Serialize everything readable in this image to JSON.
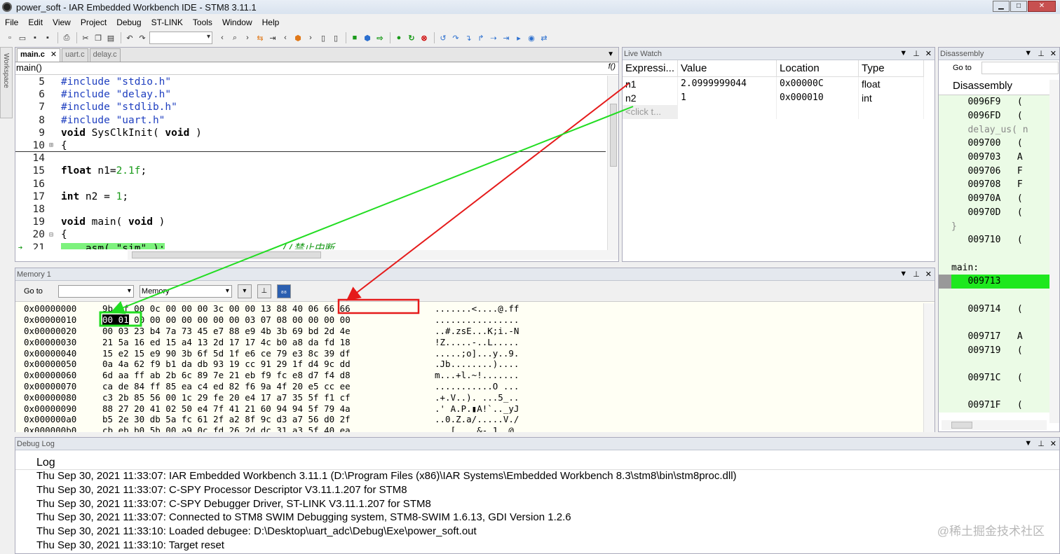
{
  "window": {
    "title": "power_soft - IAR Embedded Workbench IDE - STM8 3.11.1"
  },
  "menu": [
    "File",
    "Edit",
    "View",
    "Project",
    "Debug",
    "ST-LINK",
    "Tools",
    "Window",
    "Help"
  ],
  "workspace_strip_label": "Workspace",
  "editor": {
    "tabs": [
      {
        "label": "main.c",
        "active": true
      },
      {
        "label": "uart.c"
      },
      {
        "label": "delay.c"
      }
    ],
    "function_scope": "main()",
    "func_button": "f()",
    "lines": [
      {
        "n": "5",
        "code": "#include \"stdio.h\""
      },
      {
        "n": "6",
        "code": "#include \"delay.h\""
      },
      {
        "n": "7",
        "code": "#include \"stdlib.h\""
      },
      {
        "n": "8",
        "code": "#include \"uart.h\""
      },
      {
        "n": "9",
        "kw": "void",
        "code": " SysClkInit( ",
        "kw2": "void",
        "tail": " )"
      },
      {
        "n": "10",
        "code": "{",
        "fold": "⊞"
      },
      {
        "n": "14",
        "code": ""
      },
      {
        "n": "15",
        "kw": "float",
        "code": " n1=",
        "num": "2.1f",
        "tail": ";"
      },
      {
        "n": "16",
        "code": ""
      },
      {
        "n": "17",
        "kw": "int",
        "code": " n2 = ",
        "num": "1",
        "tail": ";"
      },
      {
        "n": "18",
        "code": ""
      },
      {
        "n": "19",
        "kw": "void",
        "code": " main( ",
        "kw2": "void",
        "tail": " )"
      },
      {
        "n": "20",
        "code": "{",
        "fold": "⊟"
      },
      {
        "n": "21",
        "code": "    asm( \"sim\" );",
        "comment": "//禁止中断",
        "current": true
      }
    ]
  },
  "live_watch": {
    "title": "Live Watch",
    "headers": [
      "Expressi...",
      "Value",
      "Location",
      "Type"
    ],
    "rows": [
      {
        "expr": "n1",
        "value": "2.0999999044",
        "location": "0x00000C",
        "type": "float"
      },
      {
        "expr": "n2",
        "value": "1",
        "location": "0x000010",
        "type": "int"
      }
    ],
    "placeholder": "<click t..."
  },
  "disassembly": {
    "title": "Disassembly",
    "goto_label": "Go to",
    "header": "Disassembly",
    "rows": [
      {
        "text": "   0096F9   (",
        "kind": "code"
      },
      {
        "text": "   0096FD   (",
        "kind": "code"
      },
      {
        "text": "   delay_us( n",
        "kind": "src"
      },
      {
        "text": "   009700   (",
        "kind": "code"
      },
      {
        "text": "   009703   A",
        "kind": "code"
      },
      {
        "text": "   009706   F",
        "kind": "code"
      },
      {
        "text": "   009708   F",
        "kind": "code"
      },
      {
        "text": "   00970A   (",
        "kind": "code"
      },
      {
        "text": "   00970D   (",
        "kind": "code"
      },
      {
        "text": "}",
        "kind": "src"
      },
      {
        "text": "   009710   (",
        "kind": "code"
      },
      {
        "text": "",
        "kind": "blank"
      },
      {
        "text": "main:",
        "kind": "label"
      },
      {
        "text": "   009713   ",
        "kind": "pc"
      },
      {
        "text": "",
        "kind": "blank"
      },
      {
        "text": "   009714   (",
        "kind": "code"
      },
      {
        "text": "",
        "kind": "blank"
      },
      {
        "text": "   009717   A",
        "kind": "code"
      },
      {
        "text": "   009719   (",
        "kind": "code"
      },
      {
        "text": "",
        "kind": "blank"
      },
      {
        "text": "   00971C   (",
        "kind": "code"
      },
      {
        "text": "",
        "kind": "blank"
      },
      {
        "text": "   00971F   (",
        "kind": "code"
      }
    ]
  },
  "memory": {
    "title": "Memory 1",
    "goto_label": "Go to",
    "zone": "Memory",
    "rows": [
      {
        "addr": "0x00000000",
        "bytes": "9b 1f 00 0c 00 00 00 3c 00 00 13 88 40 06 66 66",
        "ascii": ".......<....@.ff"
      },
      {
        "addr": "0x00000010",
        "bytes": "00 01 00 00 00 00 00 00 00 03 07 08 00 00 00 00",
        "ascii": "................"
      },
      {
        "addr": "0x00000020",
        "bytes": "00 03 23 b4 7a 73 45 e7 88 e9 4b 3b 69 bd 2d 4e",
        "ascii": "..#.zsE...K;i.-N"
      },
      {
        "addr": "0x00000030",
        "bytes": "21 5a 16 ed 15 a4 13 2d 17 17 4c b0 a8 da fd 18",
        "ascii": "!Z.....-..L....."
      },
      {
        "addr": "0x00000040",
        "bytes": "15 e2 15 e9 90 3b 6f 5d 1f e6 ce 79 e3 8c 39 df",
        "ascii": ".....;o]...y..9."
      },
      {
        "addr": "0x00000050",
        "bytes": "0a 4a 62 f9 b1 da db 93 19 cc 91 29 1f d4 9c dd",
        "ascii": ".Jb........)...."
      },
      {
        "addr": "0x00000060",
        "bytes": "6d aa ff ab 2b 6c 89 7e 21 eb f9 fc e8 d7 f4 d8",
        "ascii": "m...+l.~!......."
      },
      {
        "addr": "0x00000070",
        "bytes": "ca de 84 ff 85 ea c4 ed 82 f6 9a 4f 20 e5 cc ee",
        "ascii": "...........O ..."
      },
      {
        "addr": "0x00000080",
        "bytes": "c3 2b 85 56 00 1c 29 fe 20 e4 17 a7 35 5f f1 cf",
        "ascii": ".+.V..). ...5_.."
      },
      {
        "addr": "0x00000090",
        "bytes": "88 27 20 41 02 50 e4 7f 41 21 60 94 94 5f 79 4a",
        "ascii": ".' A.P.▮A!`.._yJ"
      },
      {
        "addr": "0x000000a0",
        "bytes": "b5 2e 30 db 5a fc 61 2f a2 8f 9c d3 a7 56 d0 2f",
        "ascii": "..0.Z.a/.....V./"
      },
      {
        "addr": "0x000000b0",
        "bytes": "cb eb b0 5b 00 a9 0c fd 26 2d dc 31 a3 5f 40 ea",
        "ascii": "...[....&-.1._@."
      }
    ]
  },
  "debug_log": {
    "title": "Debug Log",
    "header": "Log",
    "lines": [
      "Thu Sep 30, 2021 11:33:07: IAR Embedded Workbench 3.11.1 (D:\\Program Files (x86)\\IAR Systems\\Embedded Workbench 8.3\\stm8\\bin\\stm8proc.dll)",
      "Thu Sep 30, 2021 11:33:07: C-SPY Processor Descriptor V3.11.1.207 for STM8",
      "Thu Sep 30, 2021 11:33:07: C-SPY Debugger Driver, ST-LINK V3.11.1.207 for STM8",
      "Thu Sep 30, 2021 11:33:07: Connected to STM8 SWIM Debugging system, STM8-SWIM 1.6.13, GDI Version 1.2.6",
      "Thu Sep 30, 2021 11:33:10: Loaded debugee: D:\\Desktop\\uart_adc\\Debug\\Exe\\power_soft.out",
      "Thu Sep 30, 2021 11:33:10: Target reset"
    ]
  },
  "watermark": "@稀土掘金技术社区",
  "annotation_colors": {
    "red": "#e51b1b",
    "green": "#22dd22"
  }
}
